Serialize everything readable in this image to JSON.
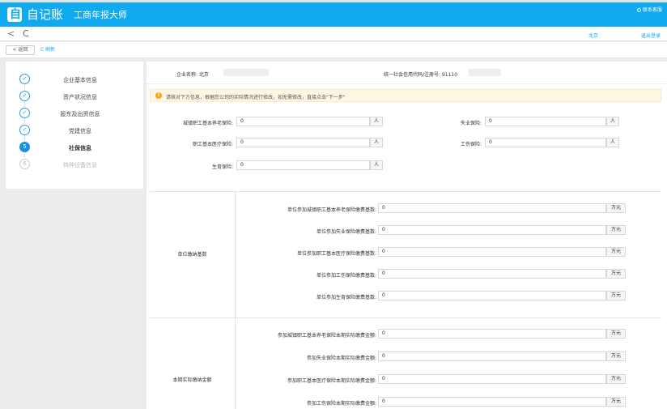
{
  "app": {
    "logo_glyph": "自",
    "brand": "自记账",
    "subtitle": "工商年报大师",
    "contact": "联系客服",
    "accent": "#10aaf0"
  },
  "nav": {
    "back": "<",
    "reload": "C",
    "user": "北京",
    "logout": "退出登录"
  },
  "toolbar": {
    "return": "< 返回",
    "refresh": "C 刷新"
  },
  "steps": [
    {
      "num": "✓",
      "label": "企业基本信息",
      "state": "done"
    },
    {
      "num": "✓",
      "label": "资产状况信息",
      "state": "done"
    },
    {
      "num": "✓",
      "label": "股东及出资信息",
      "state": "done"
    },
    {
      "num": "✓",
      "label": "党建信息",
      "state": "done"
    },
    {
      "num": "5",
      "label": "社保信息",
      "state": "active"
    },
    {
      "num": "6",
      "label": "特种设备信息",
      "state": "todo"
    }
  ],
  "company": {
    "name_label": "企业名称: 北京",
    "code_label": "统一社会信用代码/注册号: 91110"
  },
  "notice": "请核对下方信息，根据您公司的实际情况进行修改，如无需修改，直接点击\"下一步\"",
  "insurance_fields": [
    {
      "label": "城镇职工基本养老保险:",
      "value": "0",
      "unit": "人"
    },
    {
      "label": "失业保险:",
      "value": "0",
      "unit": "人"
    },
    {
      "label": "职工基本医疗保险:",
      "value": "0",
      "unit": "人"
    },
    {
      "label": "工伤保险:",
      "value": "0",
      "unit": "人"
    },
    {
      "label": "生育保险:",
      "value": "0",
      "unit": "人"
    }
  ],
  "base_section": {
    "title": "单位缴纳基数",
    "rows": [
      {
        "label": "单位参加城镇职工基本养老保险缴费基数:",
        "value": "0",
        "unit": "万元"
      },
      {
        "label": "单位参加失业保险缴费基数:",
        "value": "0",
        "unit": "万元"
      },
      {
        "label": "单位参加职工基本医疗保险缴费基数:",
        "value": "0",
        "unit": "万元"
      },
      {
        "label": "单位参加工伤保险缴费基数:",
        "value": "0",
        "unit": "万元"
      },
      {
        "label": "单位参加生育保险缴费基数:",
        "value": "0",
        "unit": "万元"
      }
    ]
  },
  "paid_section": {
    "title": "本期实际缴纳金额",
    "rows": [
      {
        "label": "参加城镇职工基本养老保险本期实际缴费金额:",
        "value": "0",
        "unit": "万元"
      },
      {
        "label": "参加失业保险本期实际缴费金额:",
        "value": "0",
        "unit": "万元"
      },
      {
        "label": "参加职工基本医疗保险本期实际缴费金额:",
        "value": "0",
        "unit": "万元"
      },
      {
        "label": "参加工伤保险本期实际缴费金额:",
        "value": "0",
        "unit": "万元"
      }
    ]
  }
}
